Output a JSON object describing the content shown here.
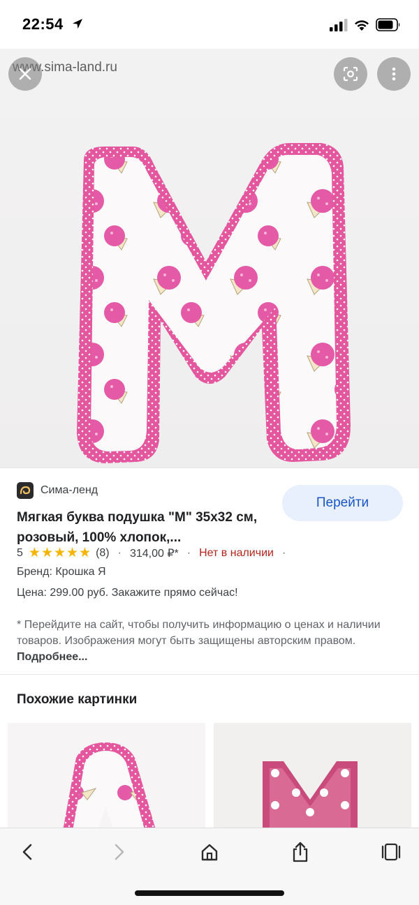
{
  "status_bar": {
    "time": "22:54"
  },
  "hero": {
    "watermark": "www.sima-land.ru"
  },
  "result": {
    "source_name": "Сима-ленд",
    "visit_label": "Перейти",
    "title": "Мягкая буква подушка \"М\" 35х32 см, розовый, 100% хлопок,...",
    "rating_value": "5",
    "stars": "★★★★★",
    "review_count": "(8)",
    "price": "314,00 ₽*",
    "availability": "Нет в наличии",
    "separator": "·",
    "brand_line": "Бренд: Крошка Я",
    "price_line": "Цена: 299.00 руб. Закажите прямо сейчас!",
    "disclaimer_text": "* Перейдите на сайт, чтобы получить информацию о ценах и наличии товаров. Изображения могут быть защищены авторским правом. ",
    "more_link": "Подробнее..."
  },
  "related": {
    "heading": "Похожие картинки"
  },
  "colors": {
    "pink": "#e4569e",
    "pink_light": "#ee7fb6",
    "link_blue": "#1a56c4",
    "button_bg": "#e8f0fe",
    "out_of_stock": "#b3261e",
    "star": "#f4b400"
  },
  "icons": {
    "close": "close-icon",
    "lens": "lens-icon",
    "more": "more-vert-icon",
    "back": "back-icon",
    "forward": "forward-icon",
    "home": "home-icon",
    "share": "share-icon",
    "tabs": "tabs-icon"
  }
}
